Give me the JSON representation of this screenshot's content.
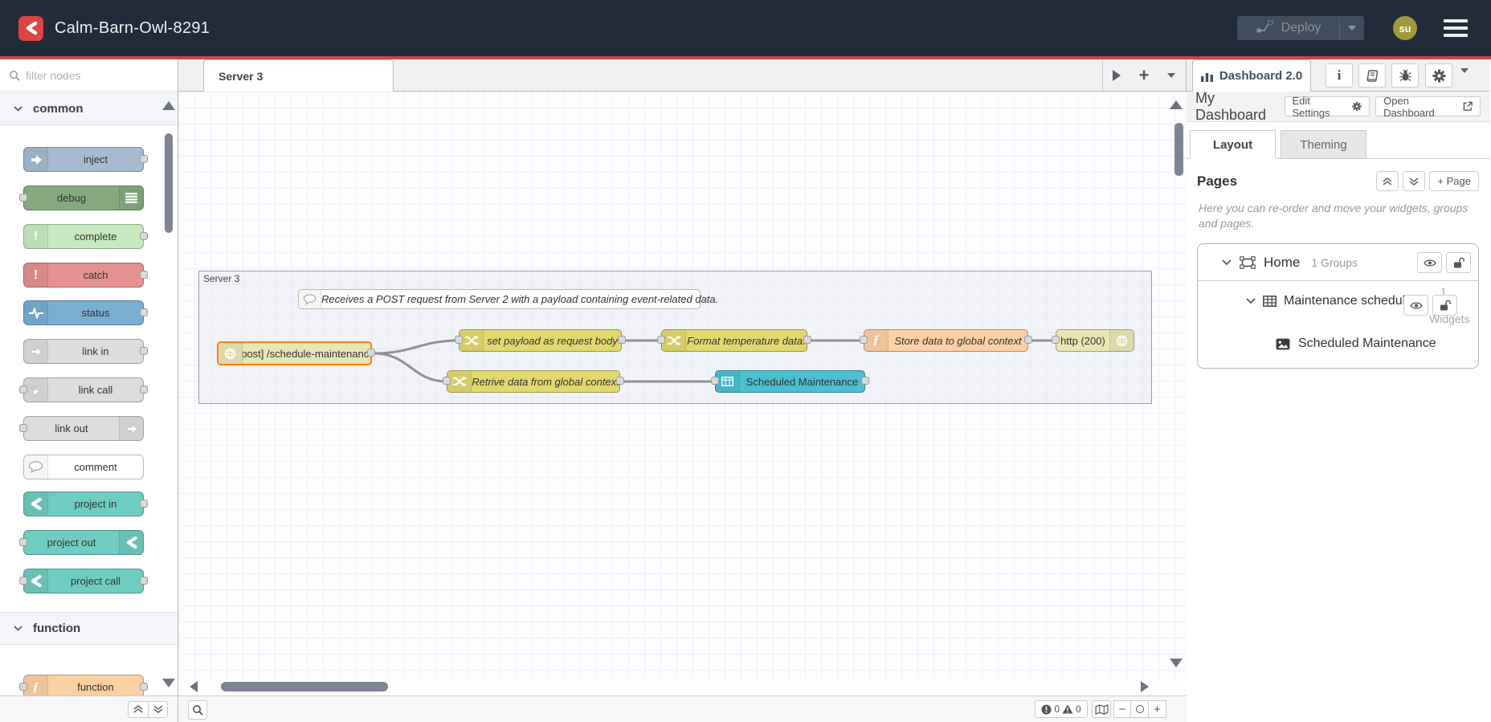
{
  "colors": {
    "header_bg": "#222b3a",
    "accent_red": "#c64848",
    "logo_red": "#dd4444",
    "deploy_bg": "#414d5c",
    "deploy_text": "#8d939c",
    "avatar_bg": "#a09a39",
    "selection_orange": "#ff7f0e",
    "wire": "#919191",
    "node_inject": "#a6bbcf",
    "node_debug": "#87a980",
    "node_complete": "#c7e9c0",
    "node_catch": "#e49191",
    "node_status": "#79aed1",
    "node_link": "#dddddd",
    "node_comment": "#ffffff",
    "node_project": "#6fccc0",
    "node_function": "#fbd0a2",
    "node_http": "#e9e6b4",
    "node_change": "#e2d96e",
    "node_table": "#4ac0d0"
  },
  "header": {
    "title": "Calm-Barn-Owl-8291",
    "deploy_label": "Deploy",
    "avatar_initials": "su"
  },
  "palette": {
    "filter_placeholder": "filter nodes",
    "category_common": "common",
    "category_function": "function",
    "nodes": {
      "inject": "inject",
      "debug": "debug",
      "complete": "complete",
      "catch": "catch",
      "status": "status",
      "link_in": "link in",
      "link_call": "link call",
      "link_out": "link out",
      "comment": "comment",
      "project_in": "project in",
      "project_out": "project out",
      "project_call": "project call",
      "function": "function"
    }
  },
  "workspace": {
    "tab_label": "Server 3",
    "add_flow": "+",
    "group_label": "Server 3",
    "comment_text": "Receives a POST request from Server 2 with a payload containing event-related data.",
    "nodes": {
      "http_in": "[post] /schedule-maintenance",
      "set_payload": "set payload as request body",
      "format_temp": "Format temperature data.",
      "store_global": "Store data to global context",
      "http_response": "http (200)",
      "retrieve_global": "Retrive data from global context",
      "ui_table": "Scheduled Maintenance"
    },
    "footer": {
      "errors": "0",
      "warnings": "0",
      "zoom_out": "−",
      "zoom_in": "+"
    }
  },
  "sidebar": {
    "tab_label": "Dashboard 2.0",
    "dashboard_name": "My Dashboard",
    "edit_settings": "Edit Settings",
    "open_dashboard": "Open Dashboard",
    "tab_layout": "Layout",
    "tab_theming": "Theming",
    "pages_title": "Pages",
    "add_page": "+ Page",
    "description": "Here you can re-order and move your widgets, groups and pages.",
    "tree": {
      "page_label": "Home",
      "page_meta": "1 Groups",
      "group_label": "Maintenance schedul...",
      "group_meta_count": "1",
      "group_meta_word": "Widgets",
      "widget_label": "Scheduled Maintenance"
    }
  }
}
